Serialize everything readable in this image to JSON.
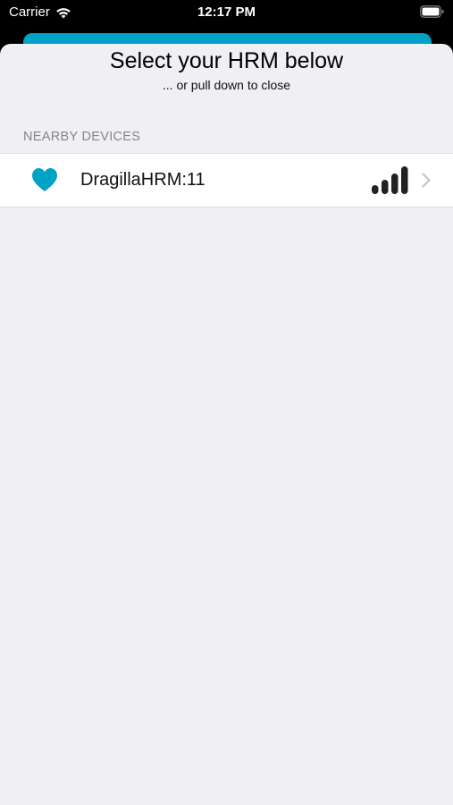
{
  "status_bar": {
    "carrier": "Carrier",
    "time": "12:17 PM",
    "wifi_icon": "wifi-icon",
    "battery_icon": "battery-icon"
  },
  "sheet": {
    "title": "Select your HRM below",
    "subtitle": "... or pull down to close",
    "section_header": "NEARBY DEVICES",
    "devices": [
      {
        "icon": "heart-icon",
        "name": "DragillaHRM:11",
        "signal_icon": "signal-strength-icon",
        "signal_bars": 4,
        "signal_bars_total": 4,
        "accessory_icon": "chevron-right-icon"
      }
    ]
  },
  "colors": {
    "accent": "#00a2c7",
    "sheet_background": "#efeff4",
    "section_header": "#86868c",
    "status_bar_background": "#000000"
  }
}
